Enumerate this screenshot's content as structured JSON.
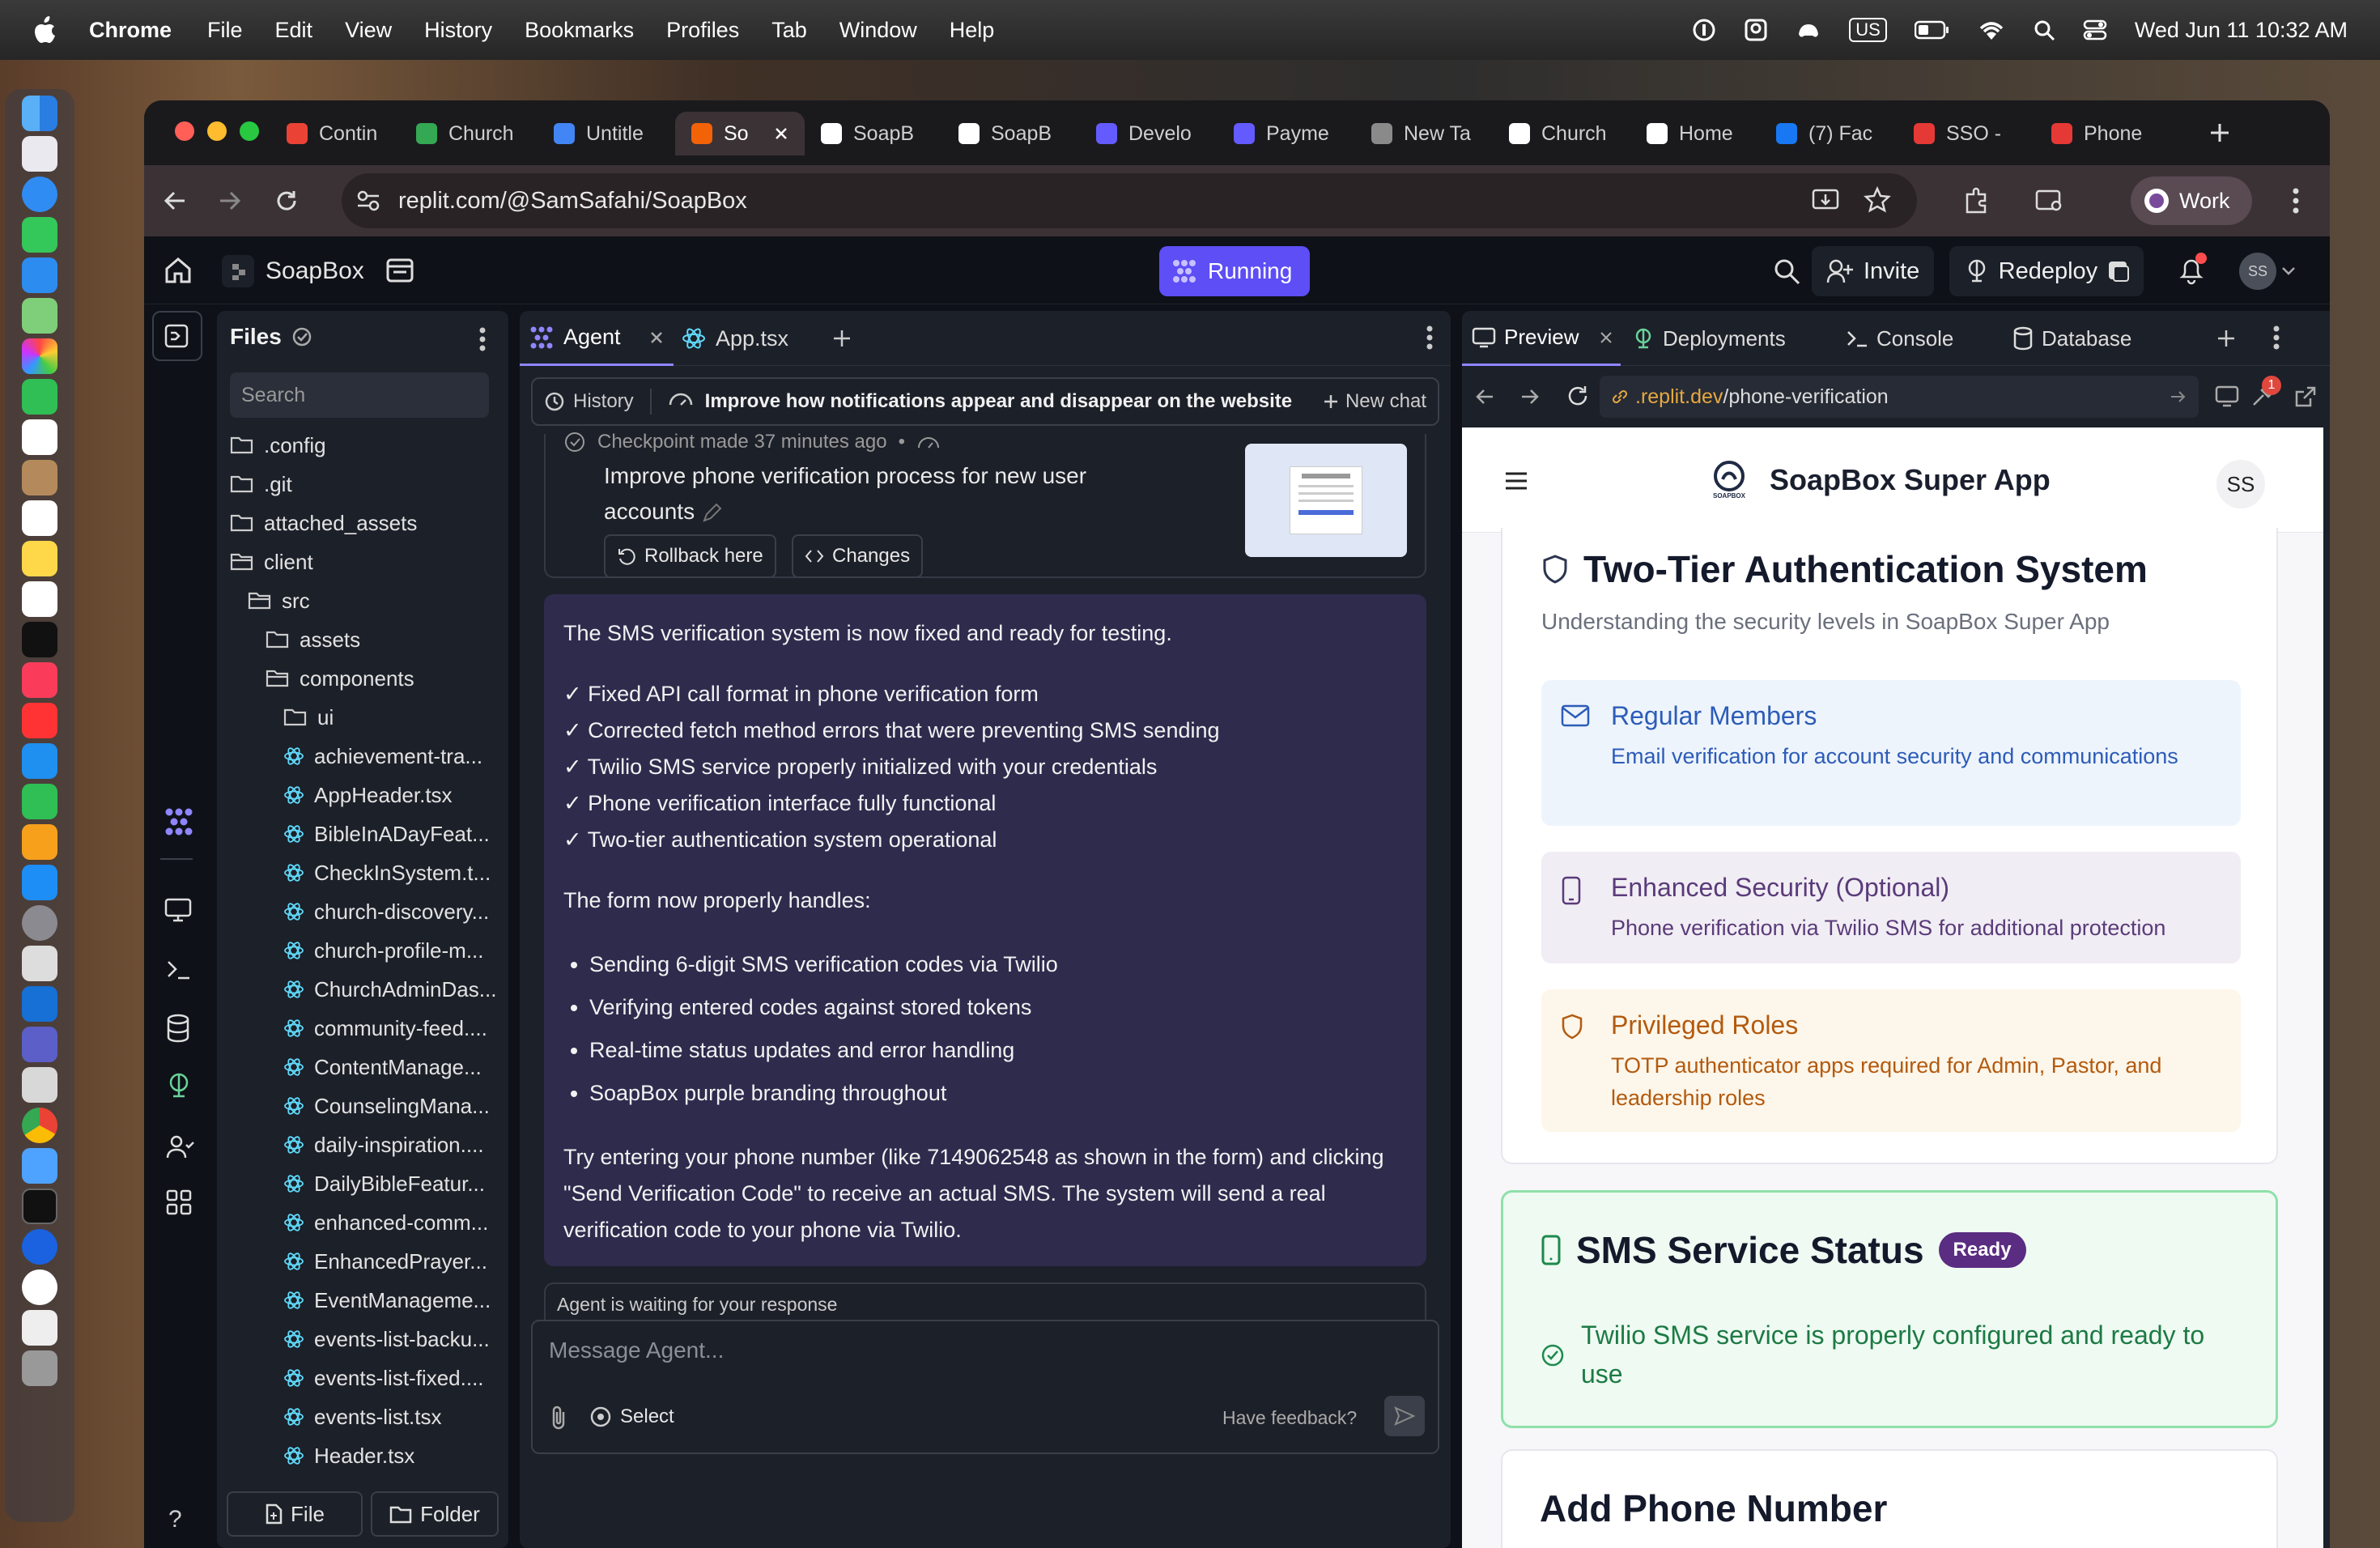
{
  "menubar": {
    "app": "Chrome",
    "items": [
      "File",
      "Edit",
      "View",
      "History",
      "Bookmarks",
      "Profiles",
      "Tab",
      "Window",
      "Help"
    ],
    "clock": "Wed Jun 11  10:32 AM",
    "keyboard": "US"
  },
  "browser": {
    "tabs": [
      {
        "label": "Contin",
        "icon": "gmail-icon",
        "color": "#ea4335"
      },
      {
        "label": "Church",
        "icon": "sheets-icon",
        "color": "#34a853"
      },
      {
        "label": "Untitle",
        "icon": "docs-icon",
        "color": "#4285f4"
      },
      {
        "label": "So",
        "icon": "replit-icon",
        "color": "#f26207",
        "active": true
      },
      {
        "label": "SoapB",
        "icon": "soapbox-icon",
        "color": "#ffffff"
      },
      {
        "label": "SoapB",
        "icon": "soapbox-icon",
        "color": "#ffffff"
      },
      {
        "label": "Develo",
        "icon": "stripe-icon",
        "color": "#635bff"
      },
      {
        "label": "Payme",
        "icon": "stripe-icon",
        "color": "#635bff"
      },
      {
        "label": "New Ta",
        "icon": "chrome-icon",
        "color": "#8a8a8a"
      },
      {
        "label": "Church",
        "icon": "soapbox-icon",
        "color": "#ffffff"
      },
      {
        "label": "Home",
        "icon": "x-icon",
        "color": "#ffffff"
      },
      {
        "label": "(7) Fac",
        "icon": "facebook-icon",
        "color": "#1877f2"
      },
      {
        "label": "SSO -",
        "icon": "sso-icon",
        "color": "#e53935"
      },
      {
        "label": "Phone",
        "icon": "sso-icon",
        "color": "#e53935"
      }
    ],
    "url": "replit.com/@SamSafahi/SoapBox",
    "profile": "Work"
  },
  "replit": {
    "project": "SoapBox",
    "status": "Running",
    "invite": "Invite",
    "redeploy": "Redeploy",
    "avatar": "SS",
    "notifications": "1"
  },
  "files": {
    "title": "Files",
    "search_placeholder": "Search",
    "items": [
      {
        "name": ".config",
        "type": "folder",
        "depth": 0
      },
      {
        "name": ".git",
        "type": "folder",
        "depth": 0
      },
      {
        "name": "attached_assets",
        "type": "folder",
        "depth": 0
      },
      {
        "name": "client",
        "type": "folder-open",
        "depth": 0
      },
      {
        "name": "src",
        "type": "folder-open",
        "depth": 1
      },
      {
        "name": "assets",
        "type": "folder",
        "depth": 2
      },
      {
        "name": "components",
        "type": "folder-open",
        "depth": 2
      },
      {
        "name": "ui",
        "type": "folder",
        "depth": 3
      },
      {
        "name": "achievement-tra...",
        "type": "react",
        "depth": 3
      },
      {
        "name": "AppHeader.tsx",
        "type": "react",
        "depth": 3
      },
      {
        "name": "BibleInADayFeat...",
        "type": "react",
        "depth": 3
      },
      {
        "name": "CheckInSystem.t...",
        "type": "react",
        "depth": 3
      },
      {
        "name": "church-discovery...",
        "type": "react",
        "depth": 3
      },
      {
        "name": "church-profile-m...",
        "type": "react",
        "depth": 3
      },
      {
        "name": "ChurchAdminDas...",
        "type": "react",
        "depth": 3
      },
      {
        "name": "community-feed....",
        "type": "react",
        "depth": 3
      },
      {
        "name": "ContentManage...",
        "type": "react",
        "depth": 3
      },
      {
        "name": "CounselingMana...",
        "type": "react",
        "depth": 3
      },
      {
        "name": "daily-inspiration....",
        "type": "react",
        "depth": 3
      },
      {
        "name": "DailyBibleFeatur...",
        "type": "react",
        "depth": 3
      },
      {
        "name": "enhanced-comm...",
        "type": "react",
        "depth": 3
      },
      {
        "name": "EnhancedPrayer...",
        "type": "react",
        "depth": 3
      },
      {
        "name": "EventManageme...",
        "type": "react",
        "depth": 3
      },
      {
        "name": "events-list-backu...",
        "type": "react",
        "depth": 3
      },
      {
        "name": "events-list-fixed....",
        "type": "react",
        "depth": 3
      },
      {
        "name": "events-list.tsx",
        "type": "react",
        "depth": 3
      },
      {
        "name": "Header.tsx",
        "type": "react",
        "depth": 3
      }
    ],
    "new_file": "File",
    "new_folder": "Folder"
  },
  "agent": {
    "tab_agent": "Agent",
    "tab_file": "App.tsx",
    "history": "History",
    "chat_title": "Improve how notifications appear and disappear on the website",
    "new_chat": "New chat",
    "checkpoint": {
      "meta": "Checkpoint made 37 minutes ago",
      "title": "Improve phone verification process for new user accounts",
      "rollback": "Rollback here",
      "changes": "Changes"
    },
    "message": {
      "intro": "The SMS verification system is now fixed and ready for testing.",
      "checks": [
        "✓ Fixed API call format in phone verification form",
        "✓ Corrected fetch method errors that were preventing SMS sending",
        "✓ Twilio SMS service properly initialized with your credentials",
        "✓ Phone verification interface fully functional",
        "✓ Two-tier authentication system operational"
      ],
      "handles_title": "The form now properly handles:",
      "bullets": [
        "Sending 6-digit SMS verification codes via Twilio",
        "Verifying entered codes against stored tokens",
        "Real-time status updates and error handling",
        "SoapBox purple branding throughout"
      ],
      "outro": "Try entering your phone number (like 7149062548 as shown in the form) and clicking \"Send Verification Code\" to receive an actual SMS. The system will send a real verification code to your phone via Twilio."
    },
    "waiting": "Agent is waiting for your response",
    "input_placeholder": "Message Agent...",
    "select": "Select",
    "feedback": "Have feedback?"
  },
  "preview": {
    "tabs": [
      "Preview",
      "Deployments",
      "Console",
      "Database"
    ],
    "url_prefix": ".replit.dev",
    "url_path": "/phone-verification",
    "badge": "1",
    "app_title": "SoapBox Super App",
    "app_logo_text": "SOAPBOX",
    "avatar": "SS",
    "auth": {
      "title": "Two-Tier Authentication System",
      "subtitle": "Understanding the security levels in SoapBox Super App",
      "tiers": [
        {
          "title": "Regular Members",
          "desc": "Email verification for account security and communications",
          "bg": "#eef4fc",
          "fg": "#2c5cb8"
        },
        {
          "title": "Enhanced Security (Optional)",
          "desc": "Phone verification via Twilio SMS for additional protection",
          "bg": "#f1edf4",
          "fg": "#5a3b7a"
        },
        {
          "title": "Privileged Roles",
          "desc": "TOTP authenticator apps required for Admin, Pastor, and leadership roles",
          "bg": "#fdf6ea",
          "fg": "#b35a0e"
        }
      ]
    },
    "sms": {
      "title": "SMS Service Status",
      "badge": "Ready",
      "text": "Twilio SMS service is properly configured and ready to use"
    },
    "next_title": "Add Phone Number"
  }
}
